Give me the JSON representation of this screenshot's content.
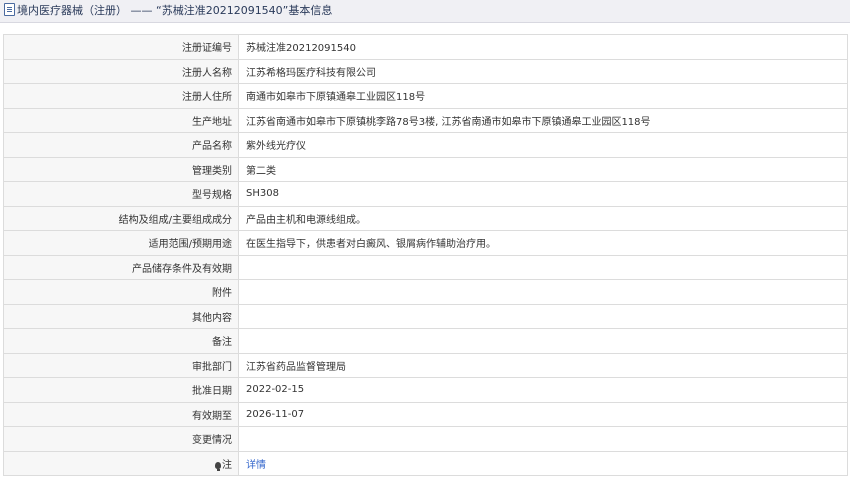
{
  "header": {
    "category": "境内医疗器械（注册）",
    "separator": "——",
    "record_title": "“苏械注准20212091540”基本信息"
  },
  "rows": [
    {
      "label": "注册证编号",
      "value": "苏械注准20212091540"
    },
    {
      "label": "注册人名称",
      "value": "江苏希格玛医疗科技有限公司"
    },
    {
      "label": "注册人住所",
      "value": "南通市如皋市下原镇通皋工业园区118号"
    },
    {
      "label": "生产地址",
      "value": "江苏省南通市如皋市下原镇桃李路78号3楼, 江苏省南通市如皋市下原镇通皋工业园区118号"
    },
    {
      "label": "产品名称",
      "value": "紫外线光疗仪"
    },
    {
      "label": "管理类别",
      "value": "第二类"
    },
    {
      "label": "型号规格",
      "value": "SH308"
    },
    {
      "label": "结构及组成/主要组成成分",
      "value": "产品由主机和电源线组成。"
    },
    {
      "label": "适用范围/预期用途",
      "value": "在医生指导下，供患者对白癜风、银屑病作辅助治疗用。"
    },
    {
      "label": "产品储存条件及有效期",
      "value": ""
    },
    {
      "label": "附件",
      "value": ""
    },
    {
      "label": "其他内容",
      "value": ""
    },
    {
      "label": "备注",
      "value": ""
    },
    {
      "label": "审批部门",
      "value": "江苏省药品监督管理局"
    },
    {
      "label": "批准日期",
      "value": "2022-02-15"
    },
    {
      "label": "有效期至",
      "value": "2026-11-07"
    },
    {
      "label": "变更情况",
      "value": ""
    }
  ],
  "note": {
    "icon": "bulb-icon",
    "label": "注",
    "link_text": "详情"
  }
}
